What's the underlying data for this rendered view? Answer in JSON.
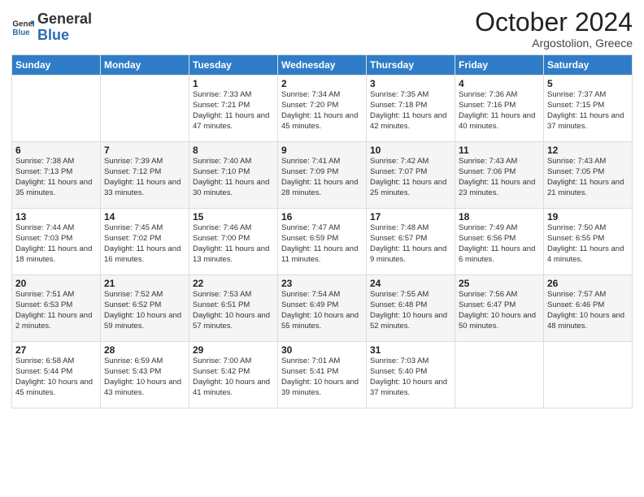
{
  "logo": {
    "text_general": "General",
    "text_blue": "Blue"
  },
  "header": {
    "month": "October 2024",
    "location": "Argostolion, Greece"
  },
  "weekdays": [
    "Sunday",
    "Monday",
    "Tuesday",
    "Wednesday",
    "Thursday",
    "Friday",
    "Saturday"
  ],
  "weeks": [
    [
      {
        "day": "",
        "info": ""
      },
      {
        "day": "",
        "info": ""
      },
      {
        "day": "1",
        "info": "Sunrise: 7:33 AM\nSunset: 7:21 PM\nDaylight: 11 hours and 47 minutes."
      },
      {
        "day": "2",
        "info": "Sunrise: 7:34 AM\nSunset: 7:20 PM\nDaylight: 11 hours and 45 minutes."
      },
      {
        "day": "3",
        "info": "Sunrise: 7:35 AM\nSunset: 7:18 PM\nDaylight: 11 hours and 42 minutes."
      },
      {
        "day": "4",
        "info": "Sunrise: 7:36 AM\nSunset: 7:16 PM\nDaylight: 11 hours and 40 minutes."
      },
      {
        "day": "5",
        "info": "Sunrise: 7:37 AM\nSunset: 7:15 PM\nDaylight: 11 hours and 37 minutes."
      }
    ],
    [
      {
        "day": "6",
        "info": "Sunrise: 7:38 AM\nSunset: 7:13 PM\nDaylight: 11 hours and 35 minutes."
      },
      {
        "day": "7",
        "info": "Sunrise: 7:39 AM\nSunset: 7:12 PM\nDaylight: 11 hours and 33 minutes."
      },
      {
        "day": "8",
        "info": "Sunrise: 7:40 AM\nSunset: 7:10 PM\nDaylight: 11 hours and 30 minutes."
      },
      {
        "day": "9",
        "info": "Sunrise: 7:41 AM\nSunset: 7:09 PM\nDaylight: 11 hours and 28 minutes."
      },
      {
        "day": "10",
        "info": "Sunrise: 7:42 AM\nSunset: 7:07 PM\nDaylight: 11 hours and 25 minutes."
      },
      {
        "day": "11",
        "info": "Sunrise: 7:43 AM\nSunset: 7:06 PM\nDaylight: 11 hours and 23 minutes."
      },
      {
        "day": "12",
        "info": "Sunrise: 7:43 AM\nSunset: 7:05 PM\nDaylight: 11 hours and 21 minutes."
      }
    ],
    [
      {
        "day": "13",
        "info": "Sunrise: 7:44 AM\nSunset: 7:03 PM\nDaylight: 11 hours and 18 minutes."
      },
      {
        "day": "14",
        "info": "Sunrise: 7:45 AM\nSunset: 7:02 PM\nDaylight: 11 hours and 16 minutes."
      },
      {
        "day": "15",
        "info": "Sunrise: 7:46 AM\nSunset: 7:00 PM\nDaylight: 11 hours and 13 minutes."
      },
      {
        "day": "16",
        "info": "Sunrise: 7:47 AM\nSunset: 6:59 PM\nDaylight: 11 hours and 11 minutes."
      },
      {
        "day": "17",
        "info": "Sunrise: 7:48 AM\nSunset: 6:57 PM\nDaylight: 11 hours and 9 minutes."
      },
      {
        "day": "18",
        "info": "Sunrise: 7:49 AM\nSunset: 6:56 PM\nDaylight: 11 hours and 6 minutes."
      },
      {
        "day": "19",
        "info": "Sunrise: 7:50 AM\nSunset: 6:55 PM\nDaylight: 11 hours and 4 minutes."
      }
    ],
    [
      {
        "day": "20",
        "info": "Sunrise: 7:51 AM\nSunset: 6:53 PM\nDaylight: 11 hours and 2 minutes."
      },
      {
        "day": "21",
        "info": "Sunrise: 7:52 AM\nSunset: 6:52 PM\nDaylight: 10 hours and 59 minutes."
      },
      {
        "day": "22",
        "info": "Sunrise: 7:53 AM\nSunset: 6:51 PM\nDaylight: 10 hours and 57 minutes."
      },
      {
        "day": "23",
        "info": "Sunrise: 7:54 AM\nSunset: 6:49 PM\nDaylight: 10 hours and 55 minutes."
      },
      {
        "day": "24",
        "info": "Sunrise: 7:55 AM\nSunset: 6:48 PM\nDaylight: 10 hours and 52 minutes."
      },
      {
        "day": "25",
        "info": "Sunrise: 7:56 AM\nSunset: 6:47 PM\nDaylight: 10 hours and 50 minutes."
      },
      {
        "day": "26",
        "info": "Sunrise: 7:57 AM\nSunset: 6:46 PM\nDaylight: 10 hours and 48 minutes."
      }
    ],
    [
      {
        "day": "27",
        "info": "Sunrise: 6:58 AM\nSunset: 5:44 PM\nDaylight: 10 hours and 45 minutes."
      },
      {
        "day": "28",
        "info": "Sunrise: 6:59 AM\nSunset: 5:43 PM\nDaylight: 10 hours and 43 minutes."
      },
      {
        "day": "29",
        "info": "Sunrise: 7:00 AM\nSunset: 5:42 PM\nDaylight: 10 hours and 41 minutes."
      },
      {
        "day": "30",
        "info": "Sunrise: 7:01 AM\nSunset: 5:41 PM\nDaylight: 10 hours and 39 minutes."
      },
      {
        "day": "31",
        "info": "Sunrise: 7:03 AM\nSunset: 5:40 PM\nDaylight: 10 hours and 37 minutes."
      },
      {
        "day": "",
        "info": ""
      },
      {
        "day": "",
        "info": ""
      }
    ]
  ]
}
